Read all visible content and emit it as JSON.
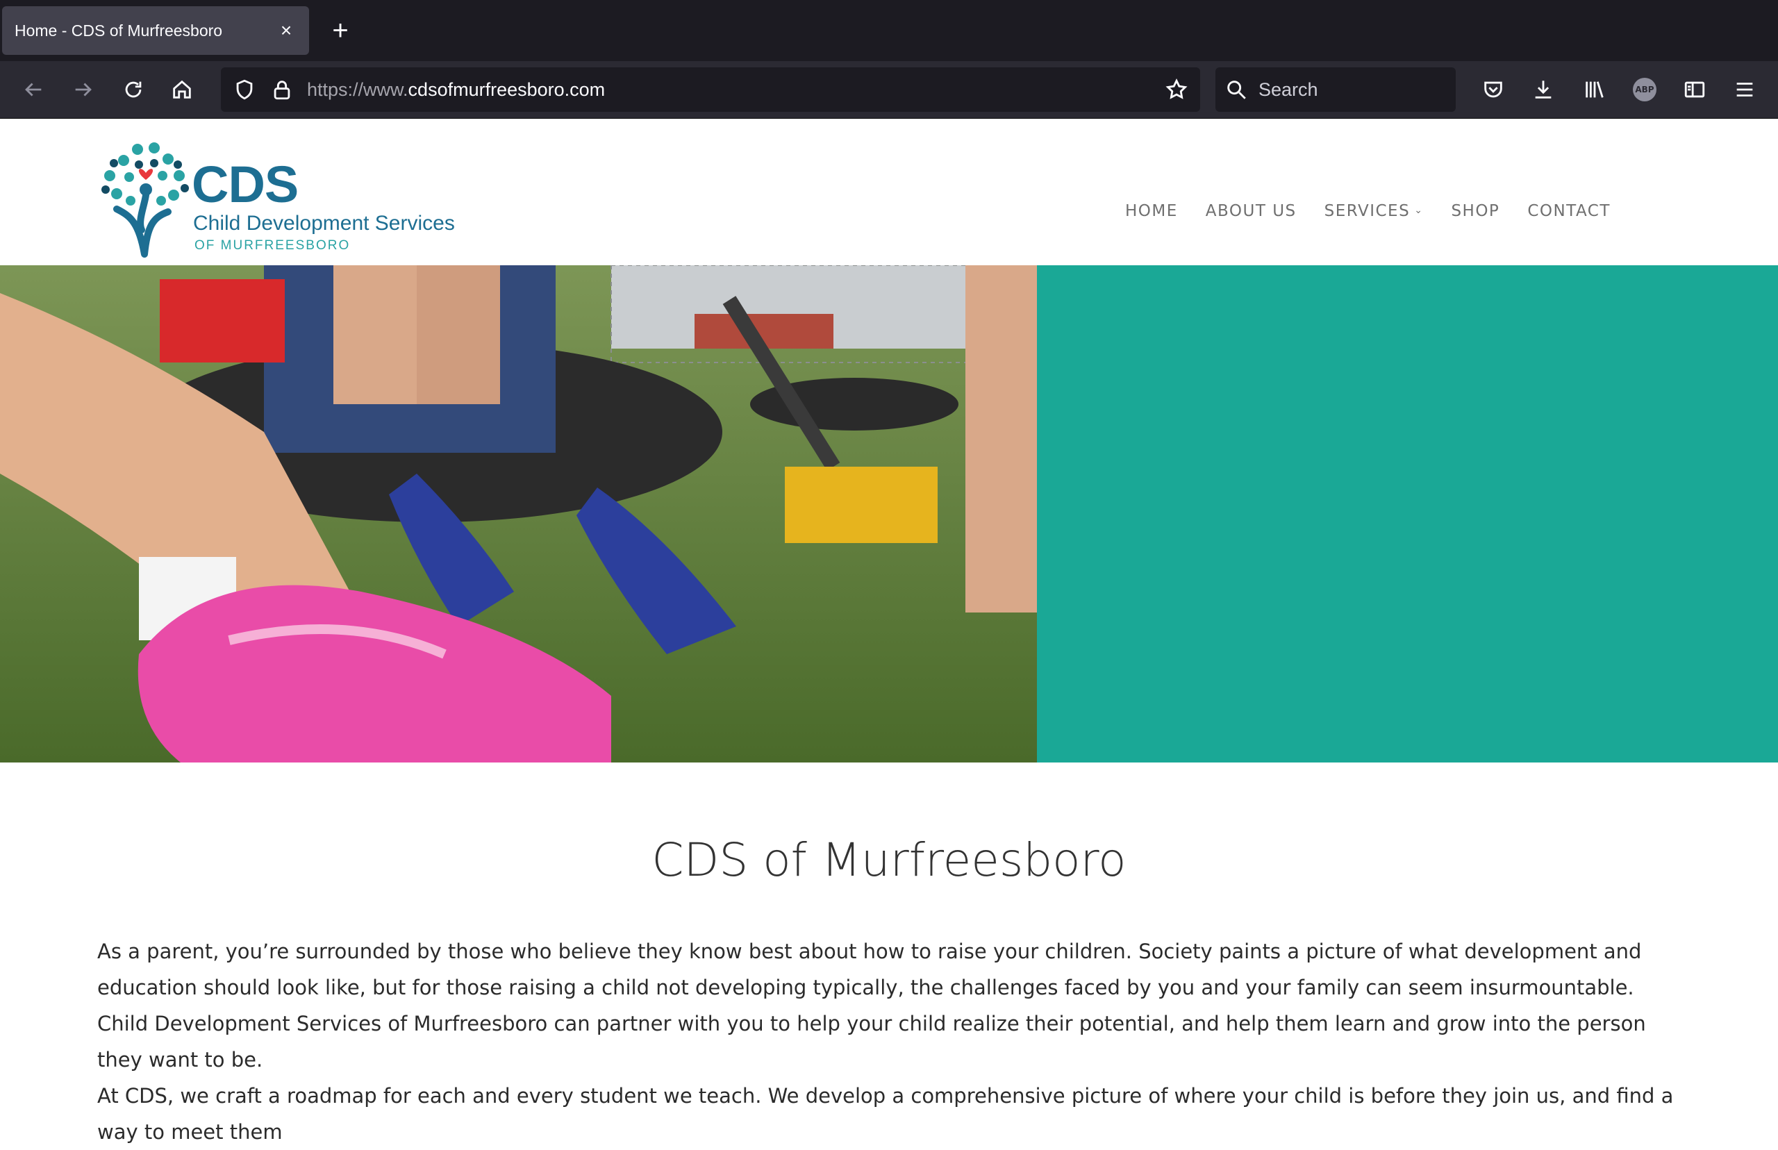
{
  "browser": {
    "tab_title": "Home - CDS of Murfreesboro",
    "tab_close": "×",
    "new_tab": "+",
    "url_prefix": "https://www.",
    "url_domain": "cdsofmurfreesboro.com",
    "search_placeholder": "Search",
    "abp_label": "ABP"
  },
  "site": {
    "logo": {
      "abbr": "CDS",
      "name": "Child Development Services",
      "sub": "OF MURFREESBORO"
    },
    "menu": [
      {
        "label": "HOME"
      },
      {
        "label": "ABOUT US"
      },
      {
        "label": "SERVICES"
      },
      {
        "label": "SHOP"
      },
      {
        "label": "CONTACT"
      }
    ],
    "services_chevron": "⌄",
    "title": "CDS of Murfreesboro",
    "paragraphs": [
      "As a parent, you’re surrounded by those who believe they know best about how to raise your children. Society paints a picture of what development and education should look like, but for those raising a child not developing typically, the challenges faced by you and your family can seem insurmountable. Child Development Services of Murfreesboro can partner with you to help your child realize their potential, and help them learn and grow into the person they want to be.",
      "At CDS, we craft a roadmap for each and every student we teach. We develop a comprehensive picture of where your child is before they join us, and find a way to meet them"
    ]
  },
  "colors": {
    "teal": "#1aa896",
    "logo_blue": "#1d6e92",
    "chrome_dark": "#1c1b22"
  }
}
